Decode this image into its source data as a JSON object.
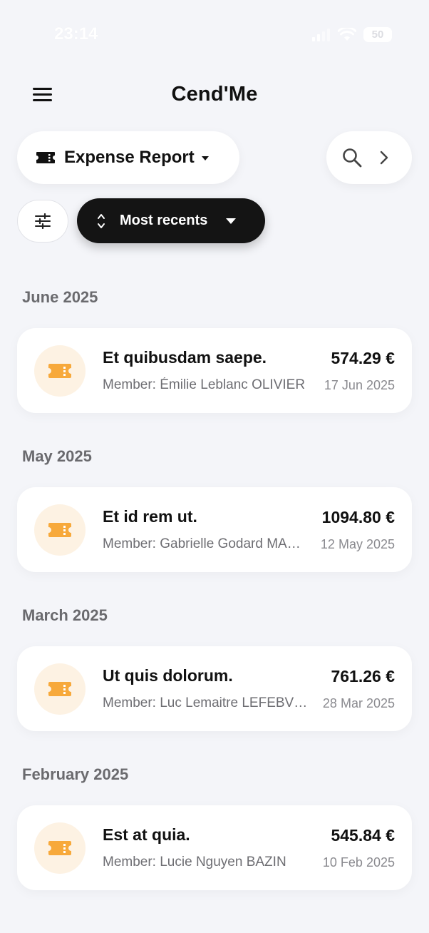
{
  "status_bar": {
    "time": "23:14",
    "battery": "50"
  },
  "header": {
    "title": "Cend'Me"
  },
  "report_selector": {
    "label": "Expense Report"
  },
  "sort": {
    "label": "Most recents"
  },
  "colors": {
    "accent": "#f7a93b",
    "icon_bg": "#fdf2e3",
    "dark": "#141414",
    "background": "#f4f5f9"
  },
  "groups": [
    {
      "month": "June 2025",
      "title": "Et quibusdam saepe.",
      "member": "Member: Émilie Leblanc OLIVIER",
      "amount": "574.29 €",
      "date": "17 Jun 2025",
      "icon": "ticket-icon"
    },
    {
      "month": "May 2025",
      "title": "Et id rem ut.",
      "member": "Member: Gabrielle Godard MARTIN",
      "amount": "1094.80 €",
      "date": "12 May 2025",
      "icon": "ticket-icon"
    },
    {
      "month": "March 2025",
      "title": "Ut quis dolorum.",
      "member": "Member: Luc Lemaitre LEFEBVRE",
      "amount": "761.26 €",
      "date": "28 Mar 2025",
      "icon": "ticket-icon"
    },
    {
      "month": "February 2025",
      "title": "Est at quia.",
      "member": "Member: Lucie Nguyen BAZIN",
      "amount": "545.84 €",
      "date": "10 Feb 2025",
      "icon": "ticket-icon"
    }
  ]
}
